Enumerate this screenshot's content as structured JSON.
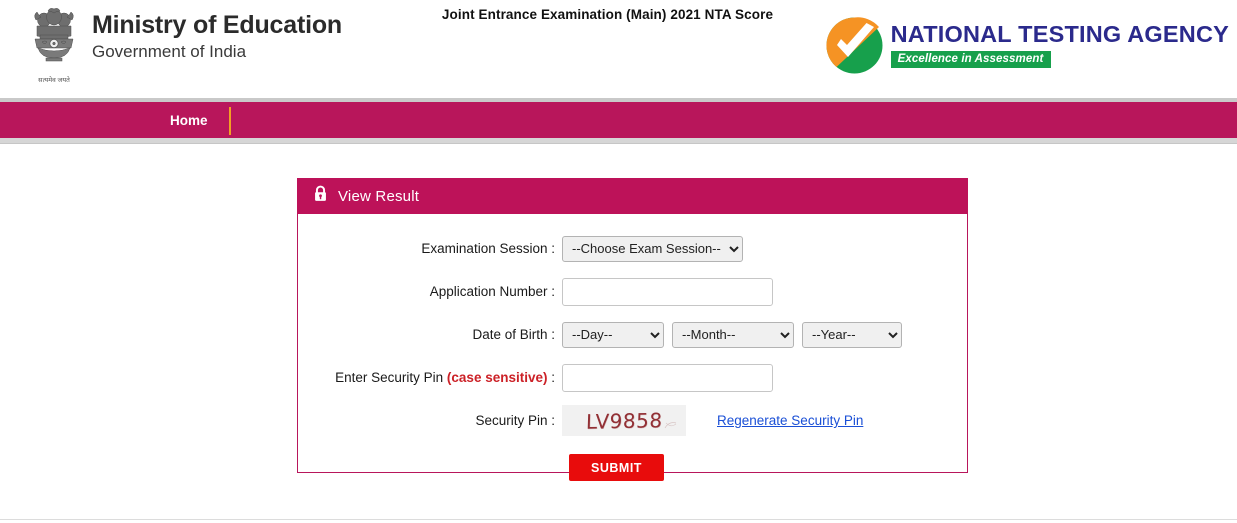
{
  "header": {
    "emblem_icon": "india-state-emblem-ashoka-lion-capital",
    "emblem_motto": "सत्यमेव जयते",
    "ministry_title": "Ministry of Education",
    "ministry_subtitle": "Government of India",
    "exam_title": "Joint Entrance Examination (Main) 2021 NTA Score",
    "nta": {
      "mark_icon": "nta-checkmark-circle-logo",
      "name": "NATIONAL TESTING AGENCY",
      "tagline": "Excellence in Assessment",
      "orange": "#f59324",
      "green": "#17a04c",
      "navy": "#2b2a8c"
    }
  },
  "nav": {
    "home_label": "Home",
    "bar_color": "#b8165b",
    "separator_color": "#f2a023"
  },
  "card": {
    "lock_icon": "lock-icon",
    "title": "View Result",
    "header_color": "#bd1259"
  },
  "form": {
    "session": {
      "label": "Examination Session :",
      "selected": "--Choose Exam Session--",
      "options": [
        "--Choose Exam Session--"
      ]
    },
    "application_number": {
      "label": "Application Number :",
      "value": "",
      "placeholder": ""
    },
    "date_of_birth": {
      "label": "Date of Birth :",
      "day": {
        "selected": "--Day--",
        "options": [
          "--Day--"
        ]
      },
      "month": {
        "selected": "--Month--",
        "options": [
          "--Month--"
        ]
      },
      "year": {
        "selected": "--Year--",
        "options": [
          "--Year--"
        ]
      }
    },
    "security_pin_entry": {
      "label_main": "Enter Security Pin ",
      "label_note": "(case sensitive)",
      "label_colon": " :",
      "value": "",
      "placeholder": ""
    },
    "security_pin_display": {
      "label": "Security Pin :",
      "captcha_text": "LV9858",
      "captcha_color": "#8a2026",
      "regenerate_label": "Regenerate Security Pin",
      "link_color": "#1a4fd6"
    },
    "submit": {
      "label": "SUBMIT",
      "color": "#e80c0c"
    }
  }
}
